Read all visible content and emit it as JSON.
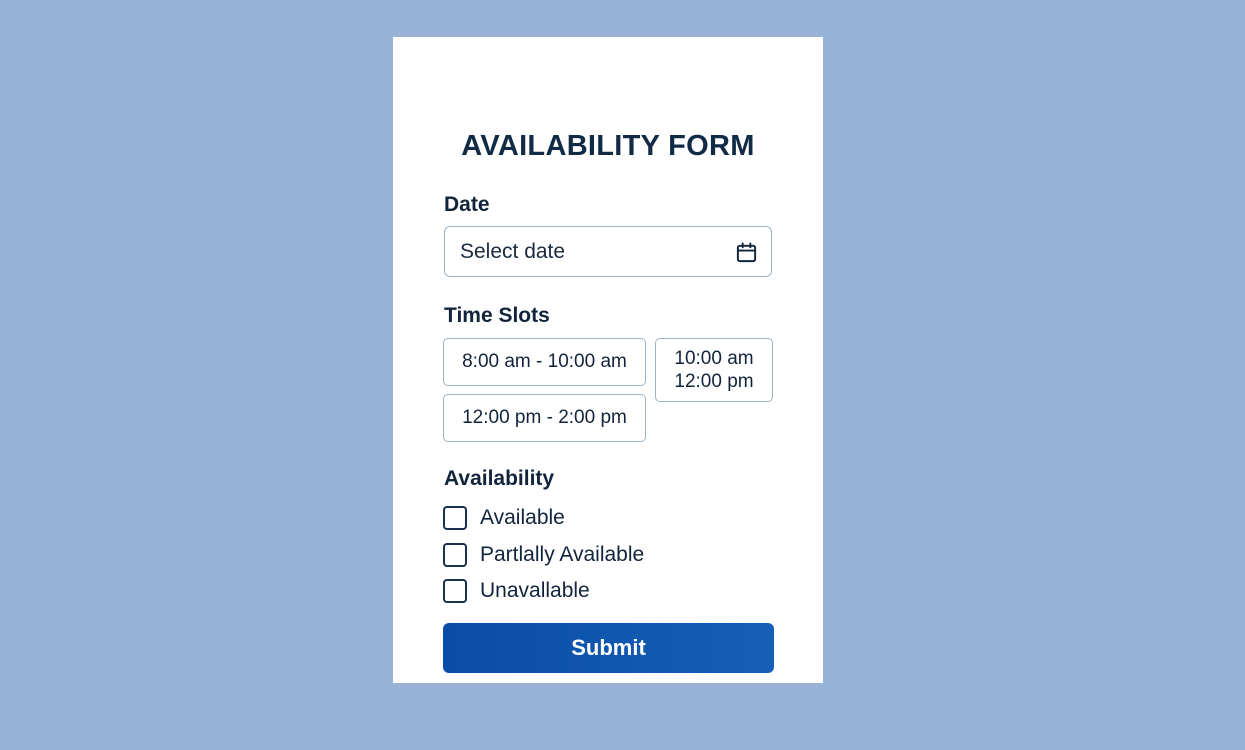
{
  "form": {
    "title": "AVAILABILITY FORM",
    "date_label": "Date",
    "date_placeholder": "Select date",
    "date_icon": "calendar-icon",
    "slots_label": "Time Slots",
    "slots": [
      {
        "line1": "8:00 am - 10:00 am"
      },
      {
        "line1": "10:00 am",
        "line2": "12:00 pm"
      },
      {
        "line1": "12:00 pm - 2:00 pm"
      }
    ],
    "availability_label": "Availability",
    "options": [
      {
        "label": "Available",
        "checked": false
      },
      {
        "label": "Partlally Available",
        "checked": false
      },
      {
        "label": "Unavallable",
        "checked": false
      }
    ],
    "submit_label": "Submit"
  },
  "colors": {
    "background": "#97b2d6",
    "card": "#ffffff",
    "text": "#12243b",
    "border": "#9fb3c6",
    "accent": "#0c52aa"
  }
}
